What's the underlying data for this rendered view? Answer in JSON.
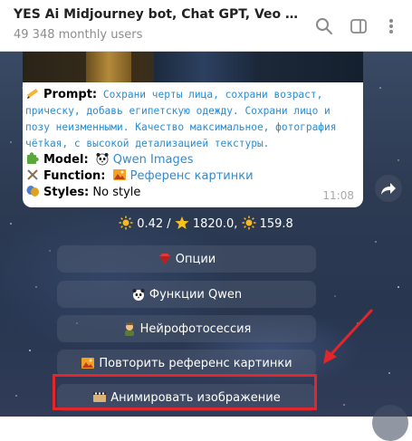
{
  "header": {
    "title": "YES Ai Midjourney bot, Chat GPT, Veo 3, Sora Ima...",
    "subtitle": "49 348 monthly users",
    "icons": [
      "search-icon",
      "sidebar-toggle-icon",
      "more-vert-icon"
    ]
  },
  "message": {
    "prompt_label": "Prompt:",
    "prompt_text": "Сохрани черты лица, сохрани возраст, прическу, добавь египетскую одежду. Сохрани лицо и позу неизменными. Качество максимальное, фотография чётkая, с высокой детализацией текстуры.",
    "model_label": "Model:",
    "model_value": "Qwen Images",
    "function_label": "Function:",
    "function_value": "Референс картинки",
    "styles_label": "Styles:",
    "styles_value": "No style",
    "time": "11:08"
  },
  "stats": {
    "a": "0.42 /",
    "b": "1820.0,",
    "c": "159.8"
  },
  "buttons": {
    "options": "Опции",
    "qwen": "Функции Qwen",
    "photosession": "Нейрофотосессия",
    "repeat": "Повторить референс картинки",
    "animate": "Анимировать изображение"
  },
  "colors": {
    "accent_link": "#2f8bd0",
    "highlight": "#e2262a"
  }
}
